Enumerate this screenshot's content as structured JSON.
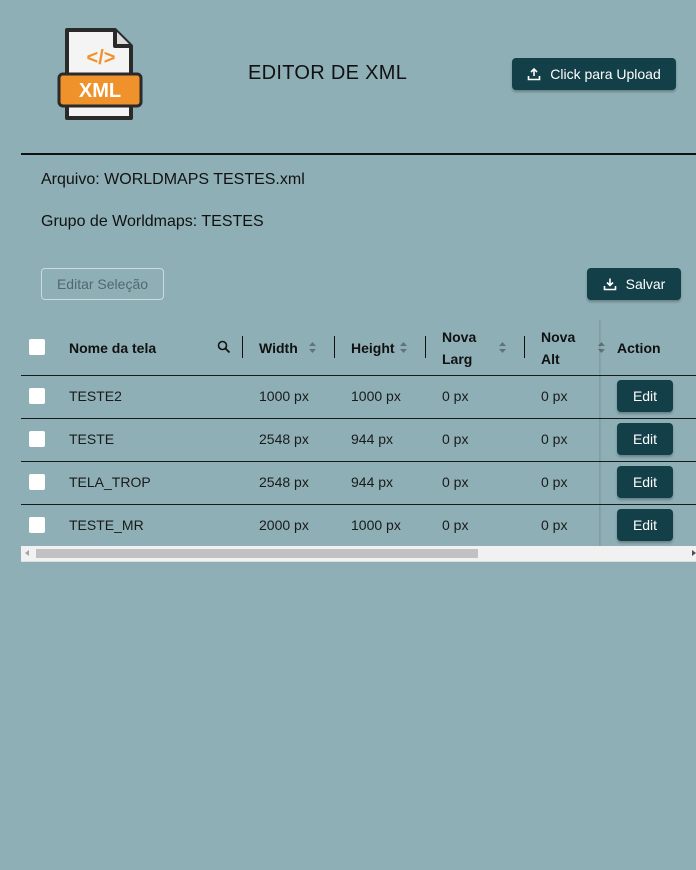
{
  "header": {
    "logo_icon": "xml-file-icon",
    "logo_text": "XML",
    "logo_code": "</>",
    "title": "EDITOR DE XML",
    "upload_label": "Click para Upload",
    "upload_icon": "upload-icon"
  },
  "info": {
    "file": "Arquivo: WORLDMAPS TESTES.xml",
    "group": "Grupo de Worldmaps: TESTES"
  },
  "toolbar": {
    "edit_selection_label": "Editar Seleção",
    "save_label": "Salvar",
    "save_icon": "download-icon"
  },
  "table": {
    "columns": {
      "name": "Nome da tela",
      "width": "Width",
      "height": "Height",
      "new_width_1": "Nova",
      "new_width_2": "Larg",
      "new_height_1": "Nova",
      "new_height_2": "Alt",
      "action": "Action"
    },
    "rows": [
      {
        "name": "TESTE2",
        "width": "1000 px",
        "height": "1000 px",
        "new_width": "0 px",
        "new_height": "0 px",
        "action": "Edit"
      },
      {
        "name": "TESTE",
        "width": "2548 px",
        "height": "944 px",
        "new_width": "0 px",
        "new_height": "0 px",
        "action": "Edit"
      },
      {
        "name": "TELA_TROP",
        "width": "2548 px",
        "height": "944 px",
        "new_width": "0 px",
        "new_height": "0 px",
        "action": "Edit"
      },
      {
        "name": "TESTE_MR",
        "width": "2000 px",
        "height": "1000 px",
        "new_width": "0 px",
        "new_height": "0 px",
        "action": "Edit"
      }
    ]
  },
  "colors": {
    "background": "#8eafb6",
    "primary_button": "#123f48",
    "logo_orange": "#f0922c"
  }
}
